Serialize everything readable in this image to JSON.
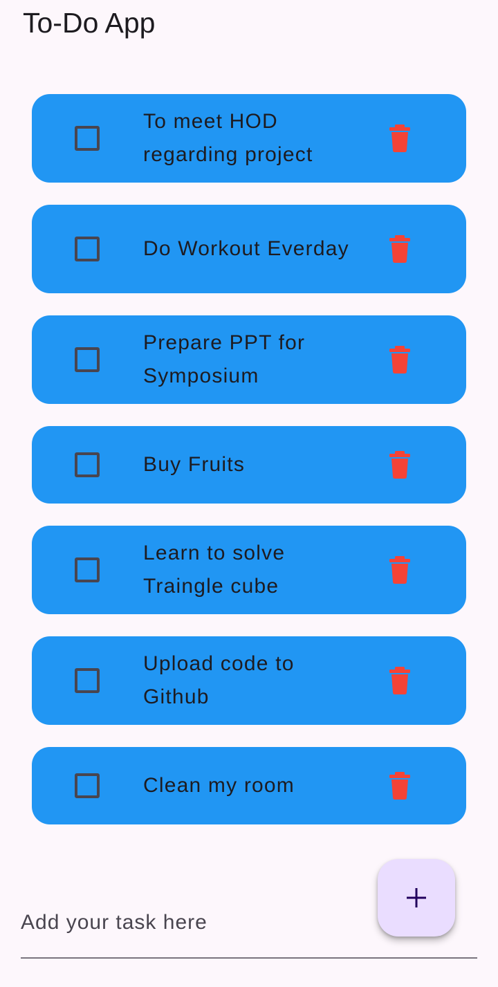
{
  "app": {
    "title": "To-Do App"
  },
  "tasks": [
    {
      "text": "To meet HOD regarding project",
      "checked": false
    },
    {
      "text": "Do Workout Everday",
      "checked": false
    },
    {
      "text": "Prepare PPT for Symposium",
      "checked": false
    },
    {
      "text": "Buy Fruits",
      "checked": false
    },
    {
      "text": "Learn to solve Traingle cube",
      "checked": false
    },
    {
      "text": "Upload code to Github",
      "checked": false
    },
    {
      "text": "Clean my room",
      "checked": false
    }
  ],
  "input": {
    "placeholder": "Add your task here",
    "value": ""
  },
  "fab": {
    "icon": "plus-icon"
  },
  "colors": {
    "background": "#fdf7fc",
    "card": "#2196f3",
    "delete": "#f44336",
    "fab": "#eaddff",
    "fab_icon": "#21005d",
    "checkbox_border": "#49454f"
  },
  "icons": {
    "delete": "trash-icon",
    "checkbox": "checkbox-icon"
  }
}
